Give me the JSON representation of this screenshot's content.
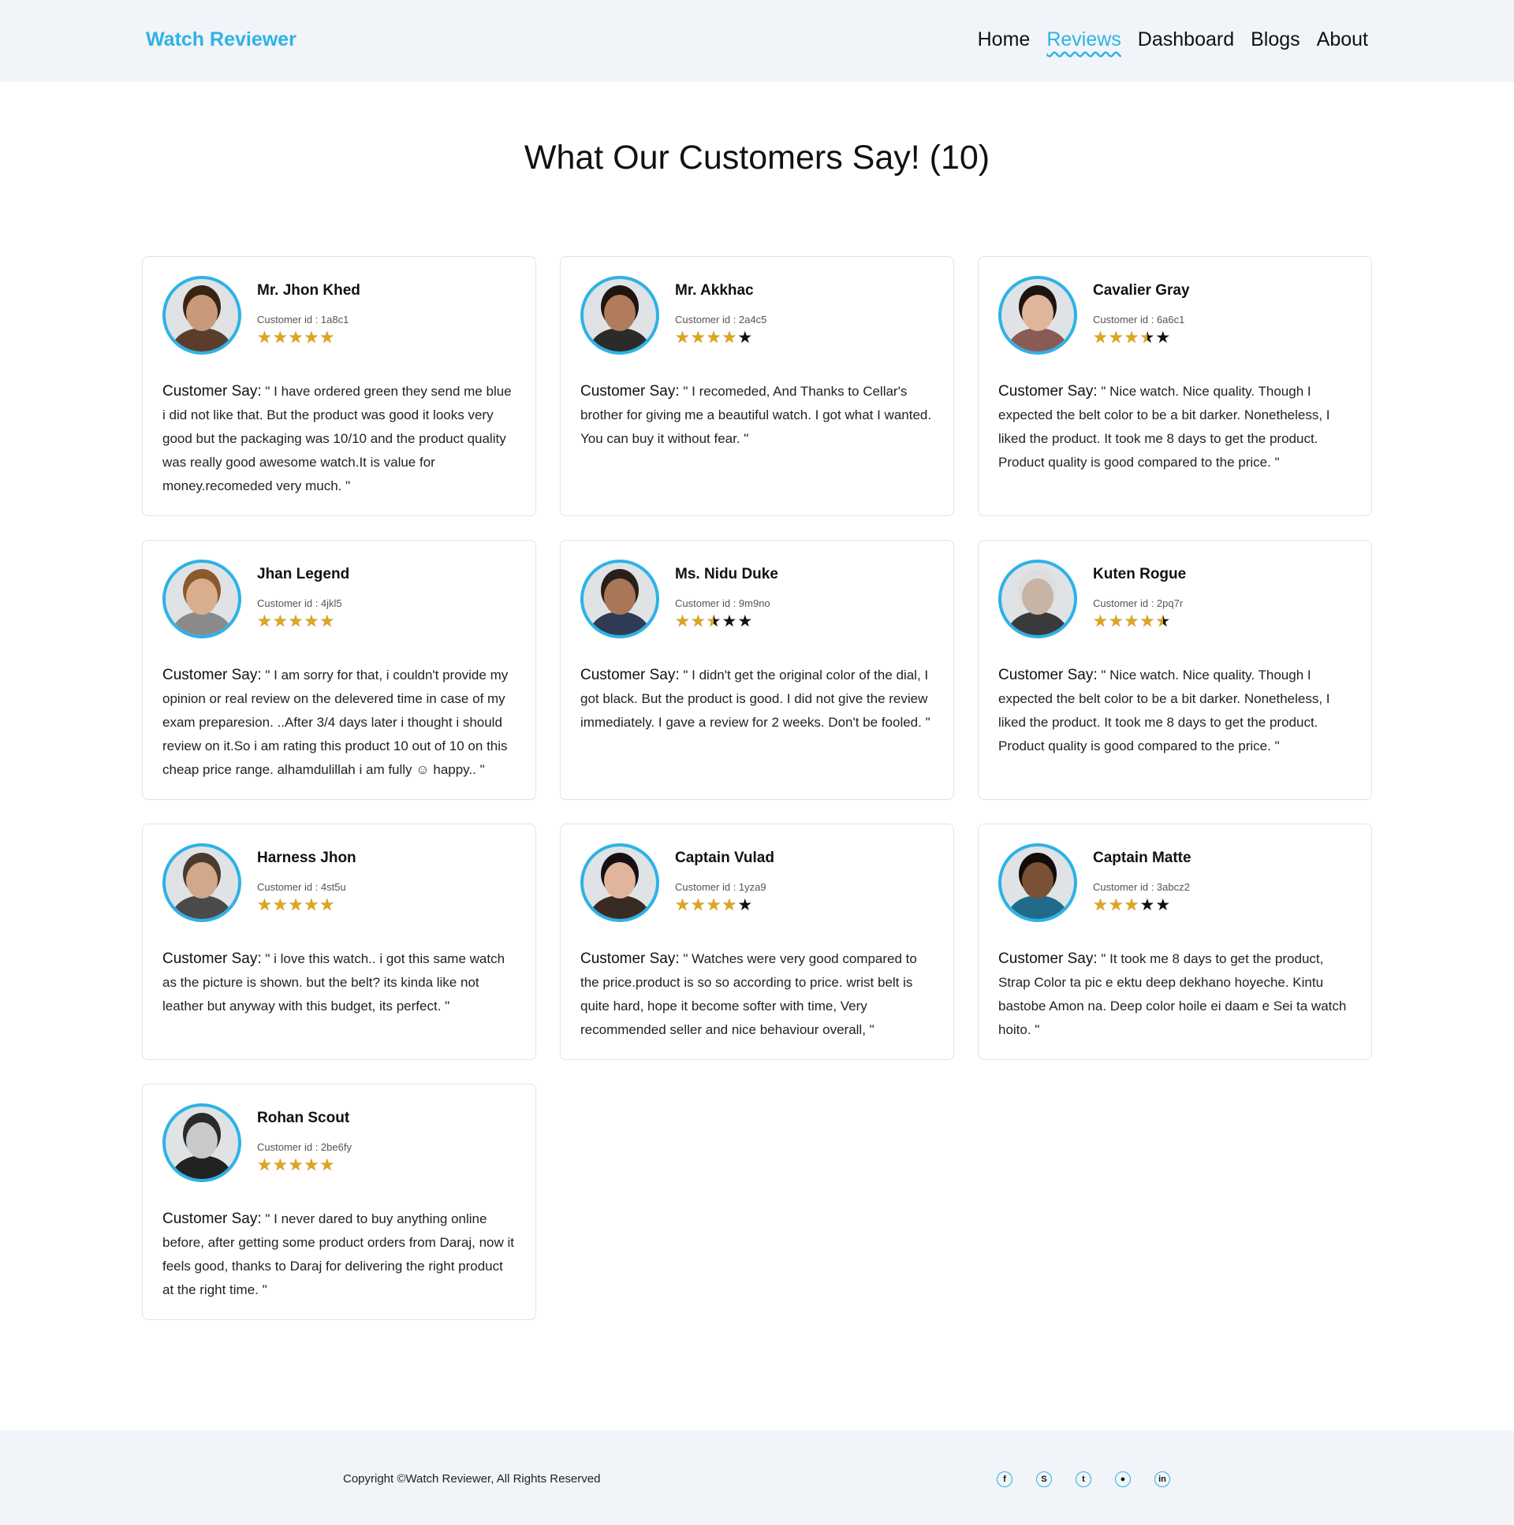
{
  "brand": "Watch Reviewer",
  "nav": [
    {
      "label": "Home",
      "active": false
    },
    {
      "label": "Reviews",
      "active": true
    },
    {
      "label": "Dashboard",
      "active": false
    },
    {
      "label": "Blogs",
      "active": false
    },
    {
      "label": "About",
      "active": false
    }
  ],
  "page_title": "What Our Customers Say! (10)",
  "say_label": "Customer Say:",
  "colors": {
    "accent": "#2eb2e6",
    "star": "#e3a41a",
    "star_empty": "#111111"
  },
  "reviews": [
    {
      "name": "Mr. Jhon Khed",
      "customer_id": "Customer id : 1a8c1",
      "rating": 5,
      "review": "\" I have ordered green they send me blue i did not like that. But the product was good it looks very good but the packaging was 10/10 and the product quality was really good awesome watch.It is value for money.recomeded very much. \""
    },
    {
      "name": "Mr. Akkhac",
      "customer_id": "Customer id : 2a4c5",
      "rating": 4,
      "review": "\" I recomeded, And Thanks to Cellar's brother for giving me a beautiful watch. I got what I wanted. You can buy it without fear. \""
    },
    {
      "name": "Cavalier Gray",
      "customer_id": "Customer id : 6a6c1",
      "rating": 3.5,
      "review": "\" Nice watch. Nice quality. Though I expected the belt color to be a bit darker. Nonetheless, I liked the product. It took me 8 days to get the product. Product quality is good compared to the price. \""
    },
    {
      "name": "Jhan Legend",
      "customer_id": "Customer id : 4jkl5",
      "rating": 5,
      "review": "\" I am sorry for that, i couldn't provide my opinion or real review on the delevered time in case of my exam preparesion. ..After 3/4 days later i thought i should review on it.So i am rating this product 10 out of 10 on this cheap price range. alhamdulillah i am fully ☺ happy.. \""
    },
    {
      "name": "Ms. Nidu Duke",
      "customer_id": "Customer id : 9m9no",
      "rating": 2.5,
      "review": "\" I didn't get the original color of the dial, I got black. But the product is good. I did not give the review immediately. I gave a review for 2 weeks. Don't be fooled. \""
    },
    {
      "name": "Kuten Rogue",
      "customer_id": "Customer id : 2pq7r",
      "rating": 4.5,
      "review": "\" Nice watch. Nice quality. Though I expected the belt color to be a bit darker. Nonetheless, I liked the product. It took me 8 days to get the product. Product quality is good compared to the price. \""
    },
    {
      "name": "Harness Jhon",
      "customer_id": "Customer id : 4st5u",
      "rating": 5,
      "review": "\" i love this watch.. i got this same watch as the picture is shown. but the belt? its kinda like not leather but anyway with this budget, its perfect. \""
    },
    {
      "name": "Captain Vulad",
      "customer_id": "Customer id : 1yza9",
      "rating": 4,
      "review": "\" Watches were very good compared to the price.product is so so according to price. wrist belt is quite hard, hope it become softer with time, Very recommended seller and nice behaviour overall, \""
    },
    {
      "name": "Captain Matte",
      "customer_id": "Customer id : 3abcz2",
      "rating": 3,
      "review": "\" It took me 8 days to get the product, Strap Color ta pic e ektu deep dekhano hoyeche. Kintu bastobe Amon na. Deep color hoile ei daam e Sei ta watch hoito. \""
    },
    {
      "name": "Rohan Scout",
      "customer_id": "Customer id : 2be6fy",
      "rating": 5,
      "review": "\" I never dared to buy anything online before, after getting some product orders from Daraj, now it feels good, thanks to Daraj for delivering the right product at the right time. \""
    }
  ],
  "footer": {
    "copyright": "Copyright ©Watch Reviewer, All Rights Reserved",
    "social": [
      {
        "icon": "facebook-icon",
        "glyph": "f"
      },
      {
        "icon": "skype-icon",
        "glyph": "S"
      },
      {
        "icon": "twitter-icon",
        "glyph": "t"
      },
      {
        "icon": "github-icon",
        "glyph": "●"
      },
      {
        "icon": "linkedin-icon",
        "glyph": "in"
      }
    ]
  }
}
